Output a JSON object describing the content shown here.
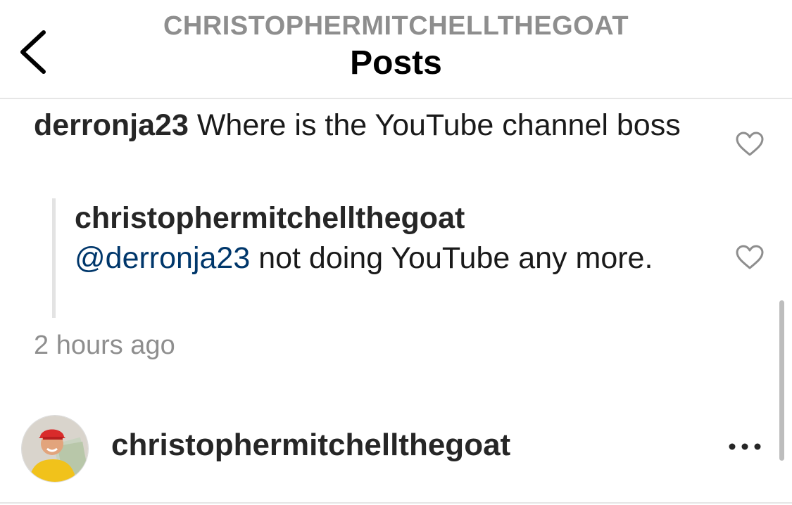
{
  "header": {
    "subtitle": "CHRISTOPHERMITCHELLTHEGOAT",
    "title": "Posts"
  },
  "comment": {
    "username": "derronja23",
    "text": "Where is the YouTube channel boss"
  },
  "reply": {
    "username": "christophermitchellthegoat",
    "mention": "@derronja23",
    "text": "not doing YouTube any more."
  },
  "timestamp": "2 hours ago",
  "post": {
    "username": "christophermitchellthegoat"
  },
  "icons": {
    "back": "chevron-left-icon",
    "like": "heart-outline-icon",
    "more": "more-horizontal-icon"
  },
  "colors": {
    "mention": "#00376b",
    "secondary_text": "#8e8e8e"
  }
}
